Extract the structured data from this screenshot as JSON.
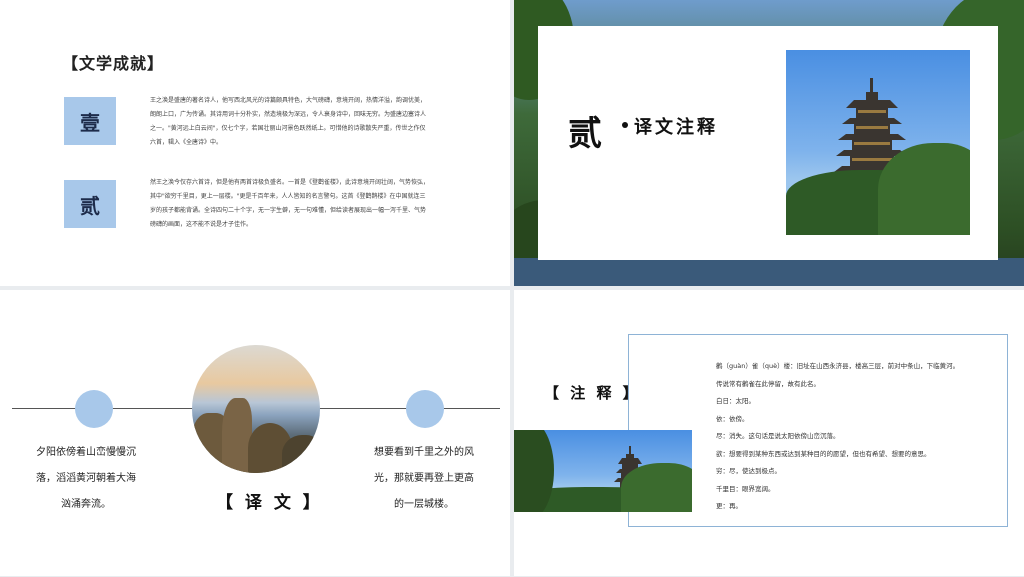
{
  "slide1": {
    "title": "【文学成就】",
    "items": [
      {
        "num": "壹",
        "lines": [
          "王之涣是盛唐的著名诗人，他写西北风光的诗篇颇具特色，大气磅礴，意境开阔，热情洋溢，韵调优美，",
          "朗朗上口，广为传诵。其诗用词十分朴实，然造境极为深远，令人衰身诗中，回味无穷。为盛唐边塞诗人",
          "之一。\"黄河远上白云间\"，仅七个字，若国壮丽山河景色跃然纸上。可惜他的诗歌散失严重，传世之作仅",
          "六首，辑入《全唐诗》中。"
        ]
      },
      {
        "num": "贰",
        "lines": [
          "然王之涣今仅存六首诗，但是他有两首诗极负盛名。一首是《登鹳雀楼》，此诗意境开阔壮阔，气势恢弘，",
          "其中\"欲穷千里目，更上一层楼。\"更是千百年来，人人皆知的名言警句。这首《登鹳鹊楼》在中国就连三",
          "岁的孩子都能背诵。全诗四句二十个字，无一字生僻，无一句难懂，但给读者展现出一幅一泻千里、气势",
          "磅礴的画面，这不能不说是才子佳作。"
        ]
      }
    ]
  },
  "slide2": {
    "big": "贰",
    "sub": "译文注释"
  },
  "slide3": {
    "left_lines": [
      "夕阳依傍着山峦慢慢沉",
      "落，滔滔黄河朝着大海",
      "汹涌奔流。"
    ],
    "right_lines": [
      "想要看到千里之外的风",
      "光，那就要再登上更高",
      "的一层城楼。"
    ],
    "title": "【 译 文 】"
  },
  "slide4": {
    "title": "【 注 释 】",
    "items": [
      "鹳（guàn）雀（què）楼：旧址在山西永济县，楼高三层，前对中条山，下临黄河。",
      "传说常有鹳雀在此停留，故有此名。",
      "白日：太阳。",
      "依：依傍。",
      "尽：消失。这句话是说太阳依傍山峦沉落。",
      "欲：想要得到某种东西或达到某种目的的愿望，但也有希望、想要的意思。",
      "穷：尽，使达到极点。",
      "千里目：眼界宽阔。",
      "更：再。"
    ]
  },
  "colors": {
    "accent_blue": "#a8c8ea",
    "border_blue": "#8eb3d6"
  },
  "icons": [
    "pagoda-photo",
    "mountain-sea-photo"
  ]
}
